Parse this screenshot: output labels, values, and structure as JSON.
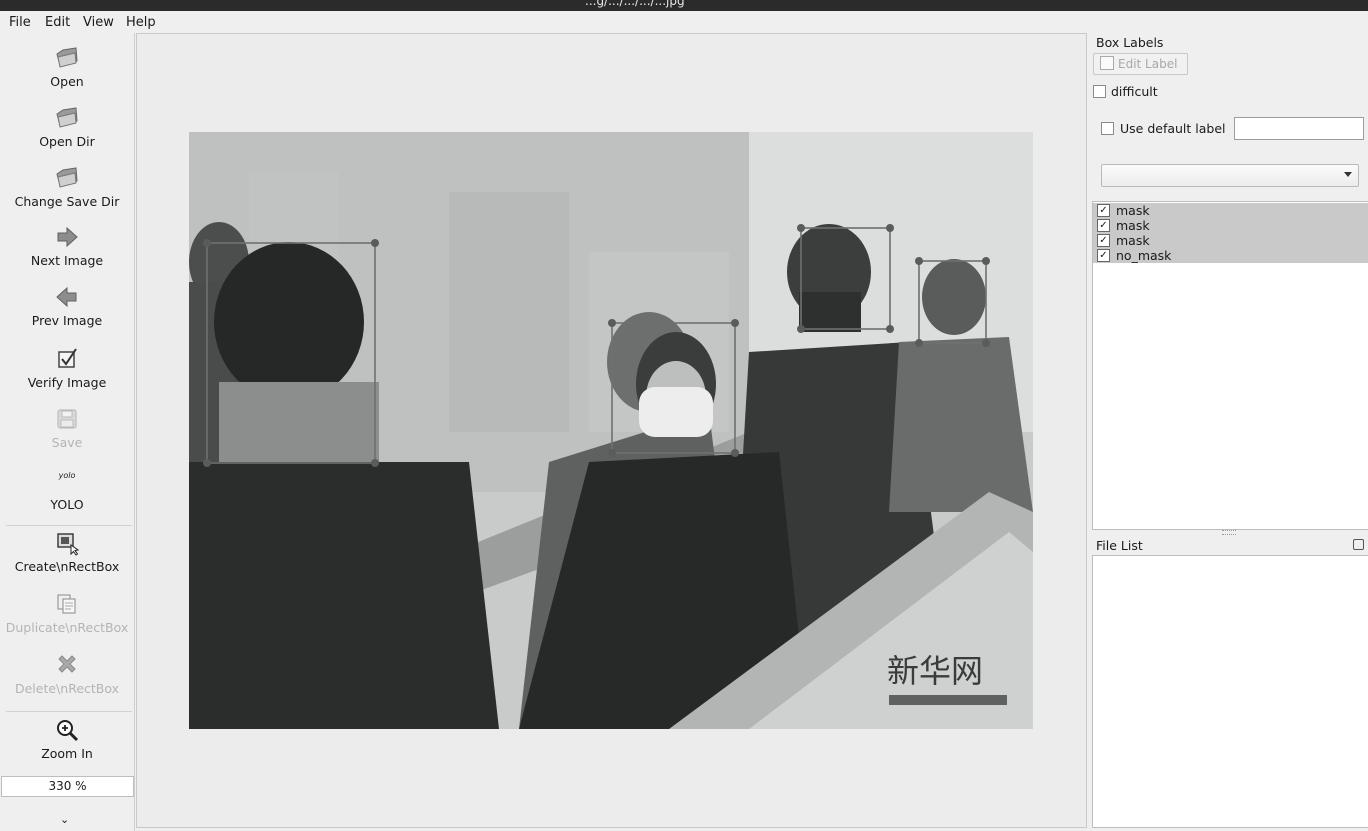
{
  "window": {
    "title": "...g/.../.../.../...jpg"
  },
  "menu": [
    "File",
    "Edit",
    "View",
    "Help"
  ],
  "toolbar": {
    "open": "Open",
    "open_dir": "Open Dir",
    "change_save_dir": "Change Save Dir",
    "next_image": "Next Image",
    "prev_image": "Prev Image",
    "verify_image": "Verify Image",
    "save": "Save",
    "yolo_icon_text": "yolo",
    "yolo": "YOLO",
    "create_rectbox": "Create\\nRectBox",
    "duplicate_rectbox": "Duplicate\\nRectBox",
    "delete_rectbox": "Delete\\nRectBox",
    "zoom_in": "Zoom In",
    "zoom_value": "330 %"
  },
  "box_labels": {
    "title": "Box Labels",
    "edit_label": "Edit Label",
    "difficult": "difficult",
    "use_default_label": "Use default label",
    "default_label_value": "",
    "labels": [
      {
        "name": "mask",
        "checked": true
      },
      {
        "name": "mask",
        "checked": true
      },
      {
        "name": "mask",
        "checked": true
      },
      {
        "name": "no_mask",
        "checked": true
      }
    ]
  },
  "file_list": {
    "title": "File List"
  },
  "image": {
    "watermark": "新华网"
  }
}
